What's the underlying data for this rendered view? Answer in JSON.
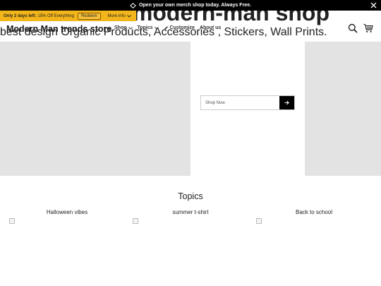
{
  "announcement": {
    "text": "Open your own merch shop today. Always Free."
  },
  "promo": {
    "days_left": "Only 2 days left:",
    "offer": "15% Off Everything",
    "redeem_label": "Redeem",
    "more_info_label": "More info"
  },
  "header": {
    "store_name": "Modern Man trends store",
    "nav": [
      {
        "label": "Shop",
        "has_dropdown": true
      },
      {
        "label": "Topics",
        "has_dropdown": true
      },
      {
        "label": "Customize",
        "icon": "pencil-icon"
      },
      {
        "label": "About us"
      }
    ]
  },
  "hero": {
    "title": "Welcome to modern-man shop",
    "subtitle": "best design Organic Products, Accessories , Stickers, Wall Prints.",
    "shop_now_label": "Shop Now"
  },
  "topics": {
    "title": "Topics",
    "items": [
      {
        "label": "Halloween vibes"
      },
      {
        "label": "summer t-shirt"
      },
      {
        "label": "Back to school"
      }
    ]
  },
  "colors": {
    "announcement_bg": "#000000",
    "promo_bg": "#f2b51b",
    "hero_bg": "#e3e3e3"
  }
}
